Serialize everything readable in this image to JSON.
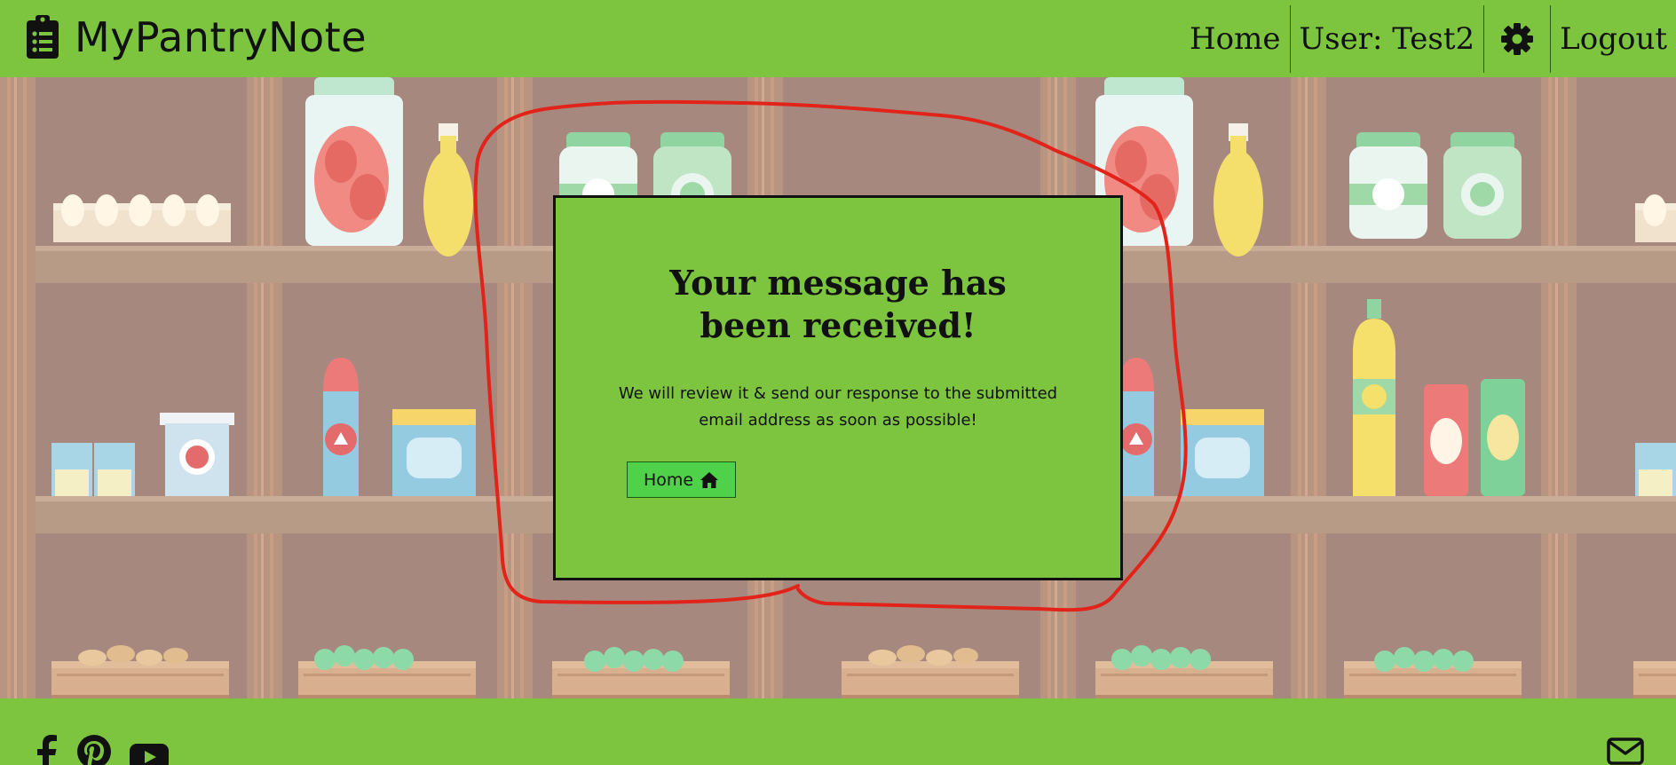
{
  "header": {
    "brand": "MyPantryNote",
    "brand_icon": "clipboard-list-icon",
    "nav": {
      "home": "Home",
      "user": "User: Test2",
      "settings_icon": "gear-icon",
      "logout": "Logout"
    }
  },
  "message_card": {
    "title": "Your message has been received!",
    "body": "We will review it & send our response to the submitted email address as soon as possible!",
    "home_button": "Home",
    "home_button_icon": "house-icon"
  },
  "footer": {
    "social_icons": [
      "facebook-icon",
      "pinterest-icon",
      "youtube-icon"
    ],
    "contact_icon": "envelope-icon"
  },
  "colors": {
    "bar_green": "#7dc53f",
    "button_green": "#4fd14a",
    "annotation_red": "#e2231a",
    "pantry_background": "#a6887f"
  }
}
